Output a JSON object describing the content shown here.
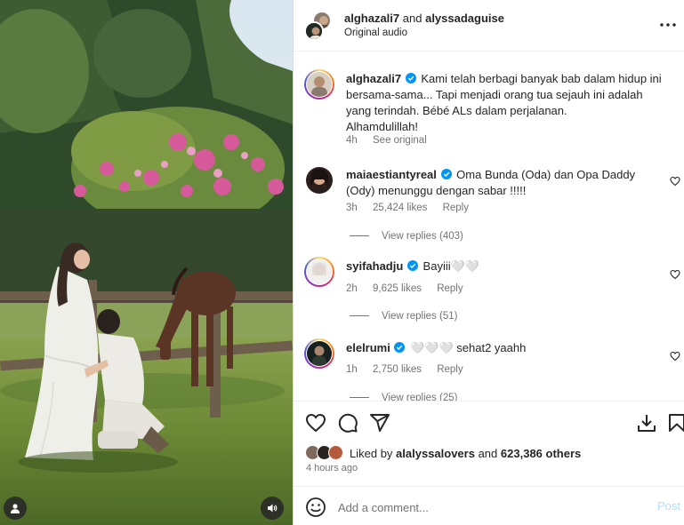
{
  "header": {
    "user1": "alghazali7",
    "joiner": "and",
    "user2": "alyssadaguise",
    "audio": "Original audio",
    "more_icon": "more-horizontal-icon"
  },
  "caption": {
    "username": "alghazali7",
    "text": "Kami telah berbagi banyak bab dalam hidup ini bersama-sama... Tapi menjadi orang tua sejauh ini adalah yang terindah. Bébé ALs dalam perjalanan.",
    "text2": "Alhamdulillah!",
    "time": "4h",
    "see_original": "See original"
  },
  "comments": [
    {
      "username": "maiaestiantyreal",
      "text": "Oma Bunda (Oda) dan Opa Daddy (Ody) menunggu dengan sabar !!!!!",
      "time": "3h",
      "likes": "25,424 likes",
      "reply": "Reply",
      "view_replies": "View replies (403)"
    },
    {
      "username": "syifahadju",
      "text": "Bayiii🤍🤍",
      "time": "2h",
      "likes": "9,625 likes",
      "reply": "Reply",
      "view_replies": "View replies (51)"
    },
    {
      "username": "elelrumi",
      "text": "🤍🤍🤍 sehat2 yaahh",
      "time": "1h",
      "likes": "2,750 likes",
      "reply": "Reply",
      "view_replies": "View replies (25)"
    }
  ],
  "actions": {
    "like_icon": "heart-icon",
    "comment_icon": "comment-icon",
    "share_icon": "share-icon",
    "download_icon": "download-icon",
    "save_icon": "bookmark-icon"
  },
  "likes": {
    "prefix": "Liked by",
    "user": "alalyssalovers",
    "middle": "and",
    "others": "623,386 others",
    "time_ago": "4 hours ago"
  },
  "add_comment": {
    "placeholder": "Add a comment...",
    "post": "Post"
  },
  "colors": {
    "verified": "#0095f6",
    "muted": "#737373",
    "post_disabled": "#b2dffc"
  }
}
